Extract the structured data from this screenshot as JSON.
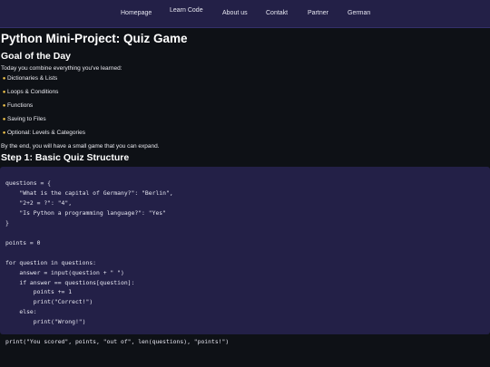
{
  "nav": {
    "items": [
      "Homepage",
      "Learn Code",
      "About us",
      "Contakt",
      "Partner",
      "German"
    ]
  },
  "page": {
    "title": "Python Mini-Project: Quiz Game",
    "goal_heading": "Goal of the Day",
    "intro": "Today you combine everything you've learned:",
    "goals": [
      "Dictionaries & Lists",
      "Loops & Conditions",
      "Functions",
      "Saving to Files",
      "Optional: Levels & Categories"
    ],
    "goal_icon": "lightbulb-icon",
    "outro": "By the end, you will have a small game that you can expand.",
    "step1_heading": "Step 1: Basic Quiz Structure"
  },
  "code": {
    "lines": [
      "questions = {",
      "    \"What is the capital of Germany?\": \"Berlin\",",
      "    \"2+2 = ?\": \"4\",",
      "    \"Is Python a programming language?\": \"Yes\"",
      "}",
      "",
      "points = 0",
      "",
      "for question in questions:",
      "    answer = input(question + \" \")",
      "    if answer == questions[question]:",
      "        points += 1",
      "        print(\"Correct!\")",
      "    else:",
      "        print(\"Wrong!\")",
      "",
      "print(\"You scored\", points, \"out of\", len(questions), \"points!\")"
    ]
  },
  "colors": {
    "nav_background": "#232047",
    "page_background": "#0e1116",
    "code_background": "#232047",
    "icon": "#f6c84c"
  }
}
